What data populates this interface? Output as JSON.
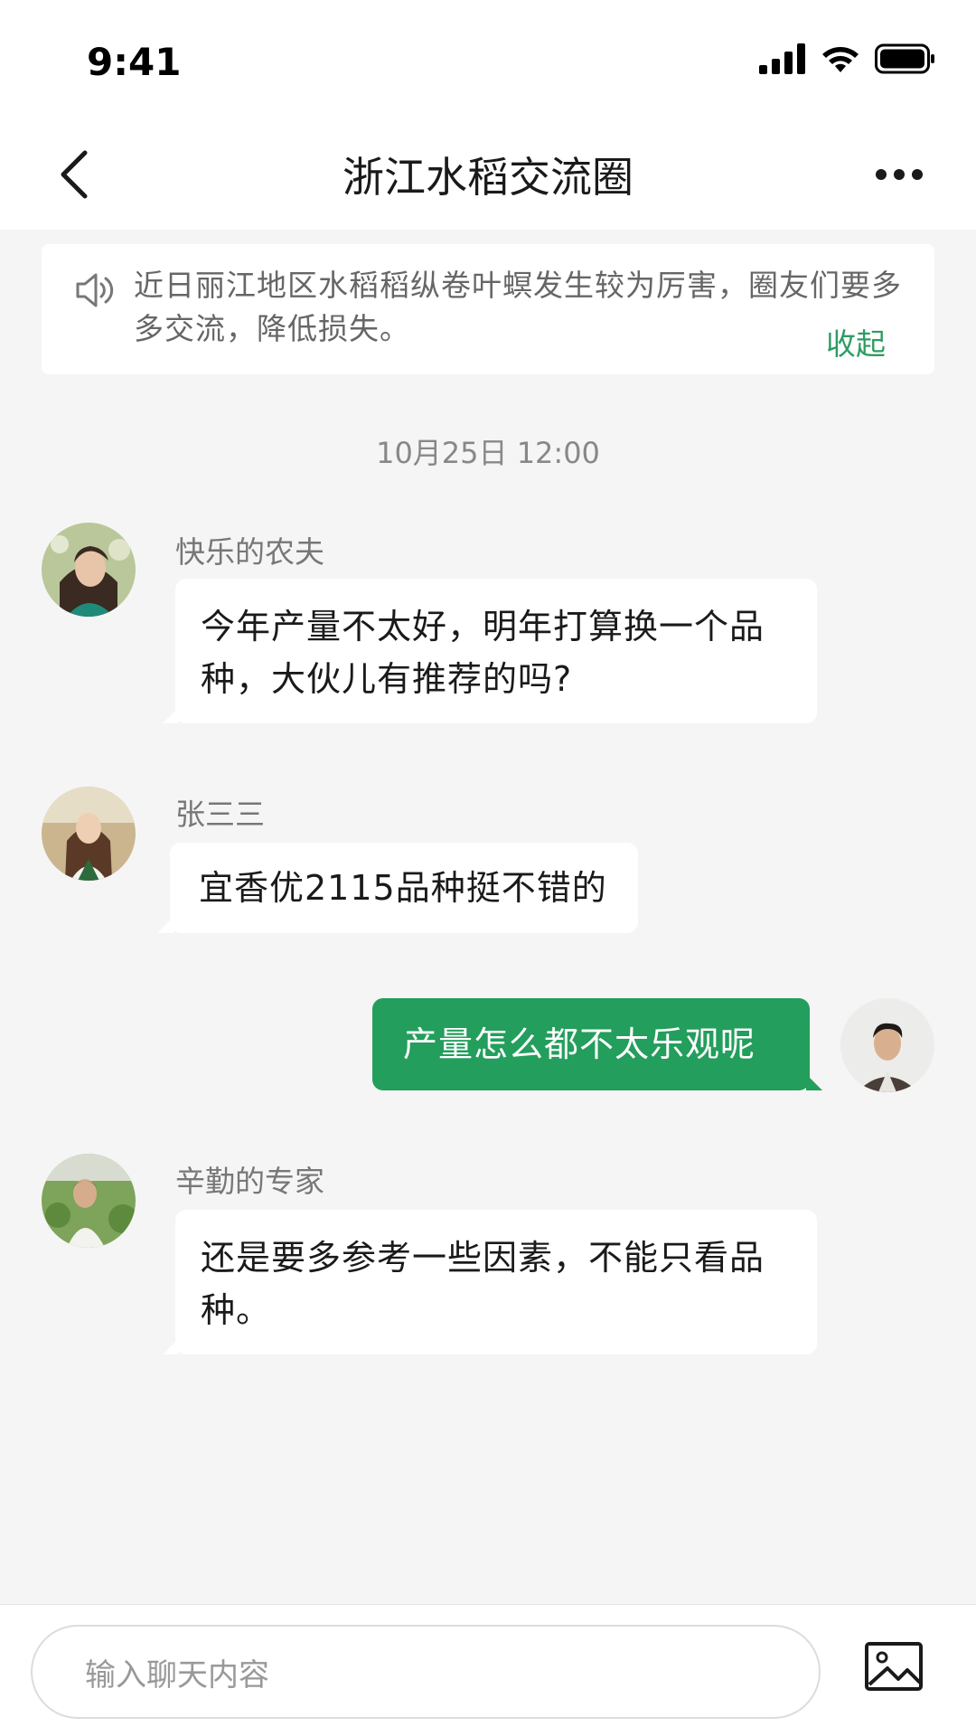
{
  "status_bar": {
    "time": "9:41"
  },
  "nav": {
    "title": "浙江水稻交流圈"
  },
  "notice": {
    "text": "近日丽江地区水稻稻纵卷叶螟发生较为厉害，圈友们要多多交流，降低损失。",
    "collapse_label": "收起"
  },
  "chat": {
    "timestamp": "10月25日 12:00",
    "messages": [
      {
        "sender": "快乐的农夫",
        "text": "今年产量不太好，明年打算换一个品种，大伙儿有推荐的吗?",
        "side": "left"
      },
      {
        "sender": "张三三",
        "text": "宜香优2115品种挺不错的",
        "side": "left"
      },
      {
        "sender": "",
        "text": "产量怎么都不太乐观呢",
        "side": "right"
      },
      {
        "sender": "辛勤的专家",
        "text": "还是要多参考一些因素，不能只看品种。",
        "side": "left"
      }
    ]
  },
  "input": {
    "placeholder": "输入聊天内容"
  },
  "icons": {
    "back": "chevron-left-icon",
    "more": "more-dots-icon",
    "notice": "speaker-icon",
    "image": "image-icon"
  },
  "colors": {
    "accent": "#239e5c",
    "link": "#2e9c62",
    "background": "#f5f5f5"
  }
}
